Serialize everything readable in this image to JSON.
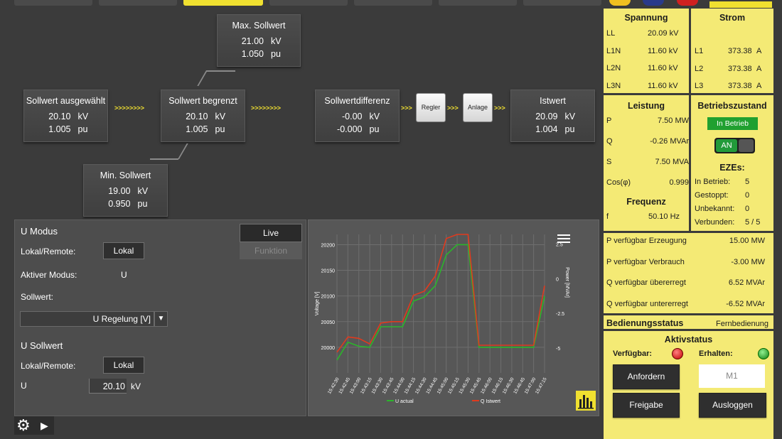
{
  "flow": {
    "max": {
      "title": "Max. Sollwert",
      "v1": "21.00",
      "u1": "kV",
      "v2": "1.050",
      "u2": "pu"
    },
    "selected": {
      "title": "Sollwert ausgewählt",
      "v1": "20.10",
      "u1": "kV",
      "v2": "1.005",
      "u2": "pu"
    },
    "limited": {
      "title": "Sollwert begrenzt",
      "v1": "20.10",
      "u1": "kV",
      "v2": "1.005",
      "u2": "pu"
    },
    "min": {
      "title": "Min. Sollwert",
      "v1": "19.00",
      "u1": "kV",
      "v2": "0.950",
      "u2": "pu"
    },
    "diff": {
      "title": "Sollwertdifferenz",
      "v1": "-0.00",
      "u1": "kV",
      "v2": "-0.000",
      "u2": "pu"
    },
    "regler": "Regler",
    "anlage": "Anlage",
    "ist": {
      "title": "Istwert",
      "v1": "20.09",
      "u1": "kV",
      "v2": "1.004",
      "u2": "pu"
    },
    "arrows": ">>>>>>>>",
    "arrows_short": ">>>"
  },
  "mode": {
    "title": "U Modus",
    "live": "Live",
    "funktion": "Funktion",
    "lokal_remote": "Lokal/Remote:",
    "lokal_btn": "Lokal",
    "aktiver_modus": "Aktiver Modus:",
    "aktiver_modus_val": "U",
    "sollwert": "Sollwert:",
    "select_val": "U Regelung [V]",
    "u_sollwert": "U Sollwert",
    "lokal_remote2": "Lokal/Remote:",
    "lokal_btn2": "Lokal",
    "u_label": "U",
    "u_value": "20.10",
    "u_unit": "kV"
  },
  "chart_data": {
    "type": "line",
    "ylabel": "Voltage [V]",
    "y2label": "Power [MVAr]",
    "ylim": [
      19950,
      20220
    ],
    "y2lim": [
      -6.8,
      3.2
    ],
    "yticks": [
      "20200",
      "20150",
      "20100",
      "20050",
      "20000"
    ],
    "y2ticks": [
      "2.5",
      "0",
      "-2.5",
      "-5"
    ],
    "categories": [
      "15:42:30",
      "15:42:45",
      "15:43:00",
      "15:43:15",
      "15:43:30",
      "15:43:45",
      "15:44:00",
      "15:44:15",
      "15:44:30",
      "15:44:45",
      "15:45:00",
      "15:45:15",
      "15:45:30",
      "15:45:45",
      "15:46:00",
      "15:46:15",
      "15:46:30",
      "15:46:45",
      "15:47:00",
      "15:47:15"
    ],
    "series": [
      {
        "name": "U actual",
        "color": "#2bb52b",
        "axis": "left",
        "values": [
          19975,
          20010,
          20002,
          20000,
          20040,
          20040,
          20040,
          20090,
          20098,
          20120,
          20180,
          20200,
          20200,
          20000,
          20000,
          20000,
          20000,
          20000,
          20000,
          20100
        ]
      },
      {
        "name": "Q Istwert",
        "color": "#e03a1e",
        "axis": "right",
        "values": [
          -5.3,
          -4.2,
          -4.3,
          -4.7,
          -3.2,
          -3.1,
          -3.1,
          -1.2,
          -0.9,
          0.2,
          2.9,
          3.2,
          3.2,
          -4.8,
          -4.8,
          -4.8,
          -4.8,
          -4.8,
          -4.8,
          -0.5
        ]
      }
    ],
    "legend": [
      "U actual",
      "Q Istwert"
    ]
  },
  "right": {
    "spannung": "Spannung",
    "strom": "Strom",
    "sp_rows": [
      {
        "k": "LL",
        "v": "20.09 kV"
      },
      {
        "k": "L1N",
        "v": "11.60 kV"
      },
      {
        "k": "L2N",
        "v": "11.60 kV"
      },
      {
        "k": "L3N",
        "v": "11.60 kV"
      }
    ],
    "st_rows": [
      {
        "k": "L1",
        "v": "373.38",
        "u": "A"
      },
      {
        "k": "L2",
        "v": "373.38",
        "u": "A"
      },
      {
        "k": "L3",
        "v": "373.38",
        "u": "A"
      }
    ],
    "leistung": "Leistung",
    "le_rows": [
      {
        "k": "P",
        "v": "7.50 MW"
      },
      {
        "k": "Q",
        "v": "-0.26 MVAr"
      },
      {
        "k": "S",
        "v": "7.50 MVA"
      },
      {
        "k": "Cos(φ)",
        "v": "0.999"
      }
    ],
    "frequenz": "Frequenz",
    "freq_k": "f",
    "freq_v": "50.10 Hz",
    "betriebszustand": "Betriebszustand",
    "in_betrieb_badge": "In Betrieb",
    "toggle": "AN",
    "ezes": "EZEs:",
    "eze_rows": [
      {
        "k": "In Betrieb:",
        "v": "5"
      },
      {
        "k": "Gestoppt:",
        "v": "0"
      },
      {
        "k": "Unbekannt:",
        "v": "0"
      },
      {
        "k": "Verbunden:",
        "v": "5 / 5"
      }
    ],
    "avail_rows": [
      {
        "k": "P verfügbar Erzeugung",
        "v": "15.00 MW"
      },
      {
        "k": "P verfügbar Verbrauch",
        "v": "-3.00 MW"
      },
      {
        "k": "Q verfügbar übererregt",
        "v": "6.52 MVAr"
      },
      {
        "k": "Q verfügbar untererregt",
        "v": "-6.52 MVAr"
      }
    ],
    "bedienungsstatus": "Bedienungsstatus",
    "fernbedienung": "Fernbedienung",
    "aktivstatus": "Aktivstatus",
    "verfuegbar": "Verfügbar:",
    "erhalten": "Erhalten:",
    "anfordern": "Anfordern",
    "m1": "M1",
    "freigabe": "Freigabe",
    "ausloggen": "Ausloggen",
    "colors": {
      "panel": "#f4ea75",
      "led_red": "#e02020",
      "led_green": "#20b020",
      "badge": "#20a030"
    }
  }
}
